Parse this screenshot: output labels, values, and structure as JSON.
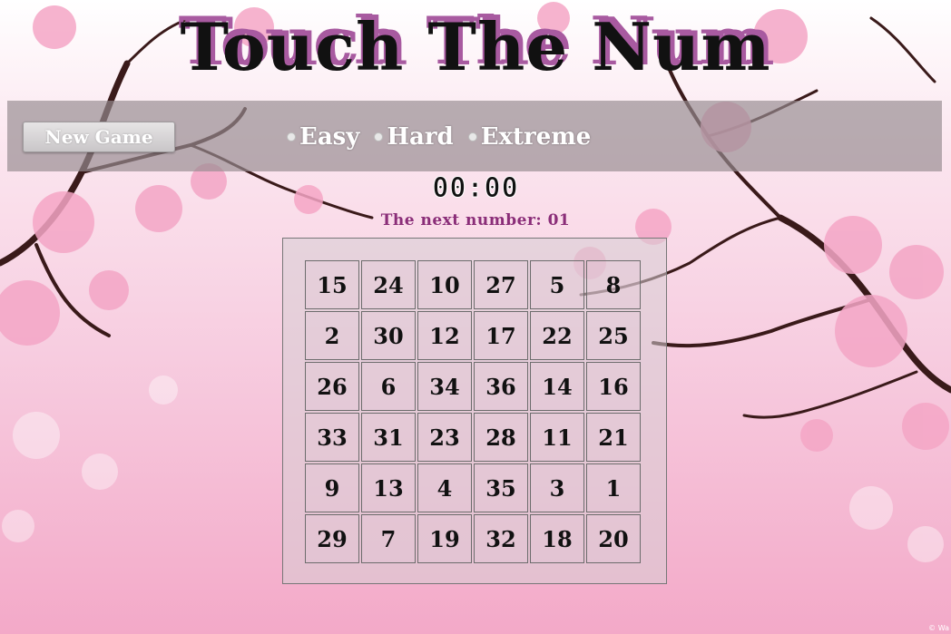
{
  "title": "Touch The Num",
  "controls": {
    "new_game_label": "New Game",
    "modes": [
      {
        "label": "Easy",
        "selected": false
      },
      {
        "label": "Hard",
        "selected": false
      },
      {
        "label": "Extreme",
        "selected": false
      }
    ]
  },
  "timer": "00:00",
  "next_number_text": "The next number: 01",
  "grid": [
    [
      "15",
      "24",
      "10",
      "27",
      "5",
      "8"
    ],
    [
      "2",
      "30",
      "12",
      "17",
      "22",
      "25"
    ],
    [
      "26",
      "6",
      "34",
      "36",
      "14",
      "16"
    ],
    [
      "33",
      "31",
      "23",
      "28",
      "11",
      "21"
    ],
    [
      "9",
      "13",
      "4",
      "35",
      "3",
      "1"
    ],
    [
      "29",
      "7",
      "19",
      "32",
      "18",
      "20"
    ]
  ],
  "watermark": "© Wa",
  "colors": {
    "title_shadow": "#a85aa0",
    "next_number": "#8a2d78",
    "bar": "#968c91"
  }
}
